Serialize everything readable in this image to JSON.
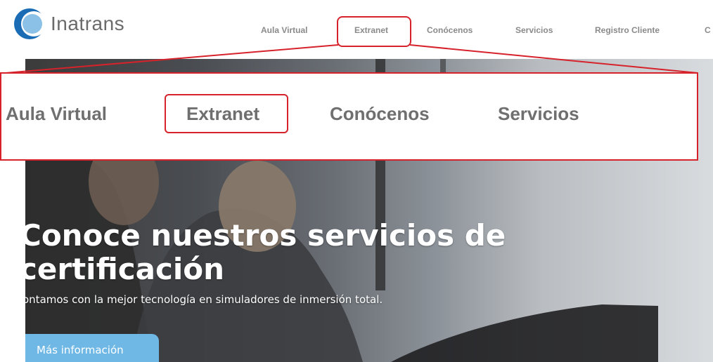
{
  "header": {
    "brand": "Inatrans",
    "nav": [
      {
        "label": "Aula Virtual"
      },
      {
        "label": "Extranet"
      },
      {
        "label": "Conócenos"
      },
      {
        "label": "Servicios"
      },
      {
        "label": "Registro Cliente"
      },
      {
        "label": "C"
      }
    ]
  },
  "hero": {
    "title": "Conoce nuestros servicios de\ncertificación",
    "subtitle": "ontamos con la mejor tecnología en simuladores de inmersión total.",
    "button_label": "Más información"
  },
  "zoom": {
    "items": [
      {
        "label": "Aula Virtual"
      },
      {
        "label": "Extranet"
      },
      {
        "label": "Conócenos"
      },
      {
        "label": "Servicios"
      }
    ]
  },
  "colors": {
    "highlight": "#d6222b",
    "button": "#6fb8e6",
    "logo_blue": "#1a6db5"
  }
}
